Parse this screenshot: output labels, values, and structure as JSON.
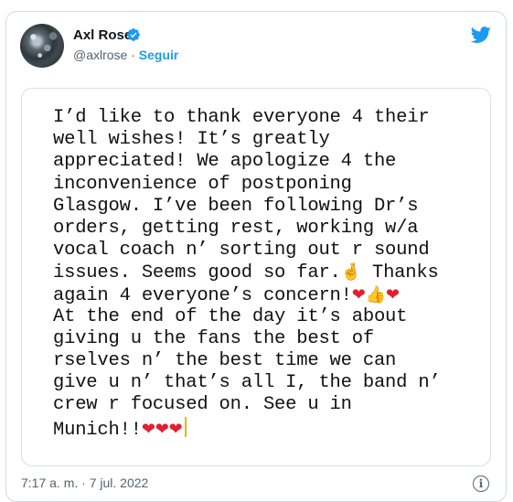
{
  "author": {
    "name": "Axl Rose",
    "handle": "@axlrose",
    "separator": "·",
    "follow_label": "Seguir"
  },
  "note": {
    "lines": [
      "I’d like to thank everyone 4 their",
      "well wishes! It’s greatly",
      "appreciated! We apologize 4 the",
      "inconvenience of postponing",
      "Glasgow. I’ve been following Dr’s",
      "orders, getting rest, working w/a",
      "vocal coach n’ sorting out r sound",
      "issues. Seems good so far.",
      "again 4 everyone’s concern!",
      "At the end of the day it’s about",
      "giving u the fans the best of",
      "rselves n’ the best time we can",
      "give u n’ that’s all I, the band n’",
      "crew r focused on. See u in",
      "Munich!!"
    ],
    "thanks_text": " Thanks",
    "emoji": {
      "crossed_fingers": "🤞",
      "heart": "❤",
      "thumbs_up": "👍"
    }
  },
  "footer": {
    "timestamp": "7:17 a. m. · 7 jul. 2022",
    "info_glyph": "i"
  },
  "colors": {
    "accent": "#1d9bf0",
    "verified": "#1d9bf0",
    "heart": "#e0202f",
    "muted": "#536471"
  }
}
